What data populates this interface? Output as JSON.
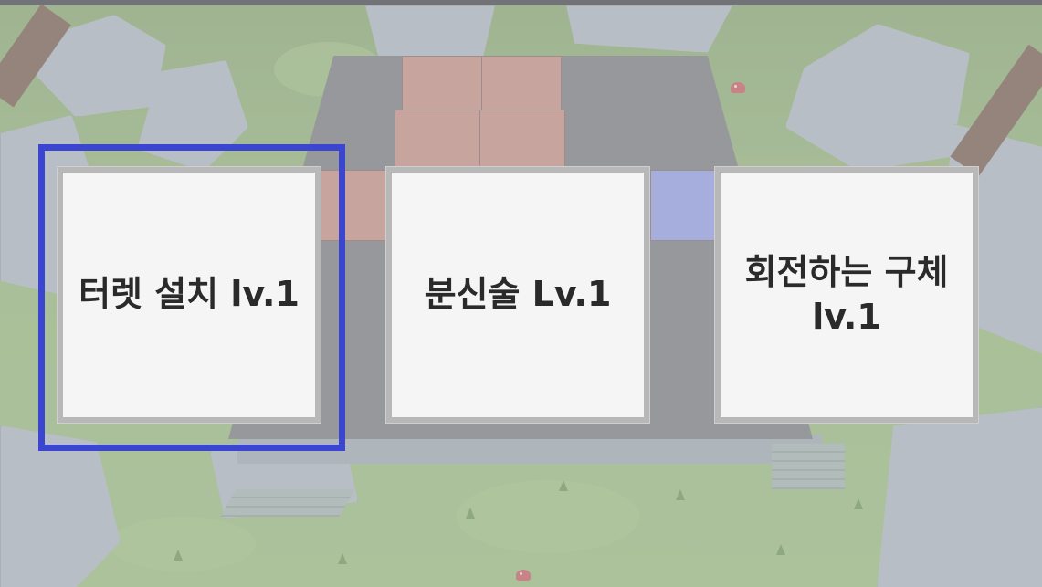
{
  "upgrade_menu": {
    "cards": [
      {
        "label": "터렛 설치 lv.1",
        "selected": true
      },
      {
        "label": "분신술 Lv.1",
        "selected": false
      },
      {
        "label": "회전하는 구체 lv.1",
        "selected": false
      }
    ],
    "selection_color": "#3a45d0"
  },
  "scene": {
    "arena_tile_colors": {
      "red": "#c98473",
      "blue": "#8a95e6"
    }
  }
}
